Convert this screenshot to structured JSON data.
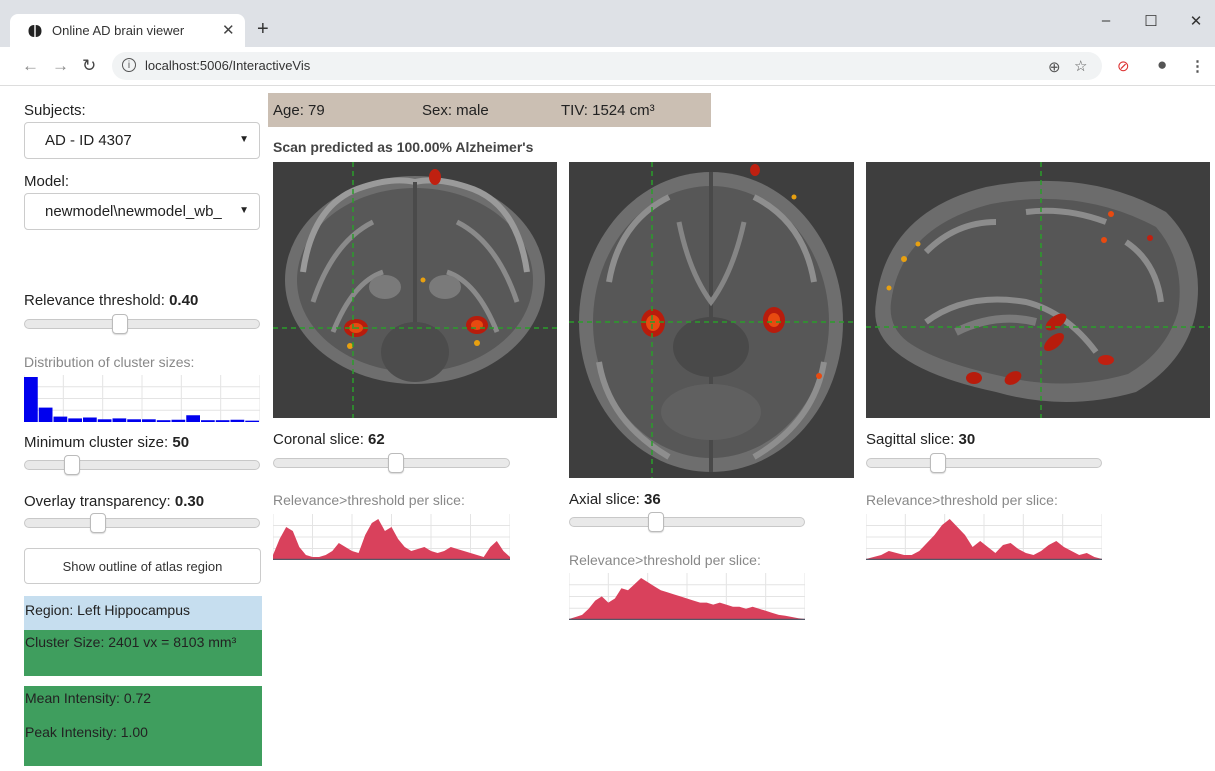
{
  "browser": {
    "tab_title": "Online AD brain viewer",
    "url": "localhost:5006/InteractiveVis"
  },
  "sidebar": {
    "subjects_label": "Subjects:",
    "subject_value": "AD - ID 4307",
    "model_label": "Model:",
    "model_value": "newmodel\\newmodel_wb_",
    "relevance_label": "Relevance threshold:",
    "relevance_value": "0.40",
    "relevance_fraction": 0.4,
    "distribution_label": "Distribution of cluster sizes:",
    "distribution_values": [
      1.0,
      0.32,
      0.12,
      0.08,
      0.1,
      0.06,
      0.08,
      0.06,
      0.06,
      0.04,
      0.05,
      0.15,
      0.04,
      0.04,
      0.05,
      0.03
    ],
    "min_cluster_label": "Minimum cluster size:",
    "min_cluster_value": "50",
    "min_cluster_fraction": 0.18,
    "overlay_label": "Overlay transparency:",
    "overlay_value": "0.30",
    "overlay_fraction": 0.3,
    "atlas_button": "Show outline of atlas region",
    "region": "Region: Left Hippocampus",
    "cluster_size": "Cluster Size: 2401 vx = 8103 mm³",
    "mean_intensity": "Mean Intensity: 0.72",
    "peak_intensity": "Peak Intensity: 1.00"
  },
  "subject_info": {
    "age": "Age: 79",
    "sex": "Sex: male",
    "tiv": "TIV: 1524 cm³"
  },
  "prediction": "Scan predicted as 100.00% Alzheimer's",
  "views": {
    "coronal": {
      "slice_label": "Coronal slice:",
      "slice_value": "62",
      "slider_fraction": 0.52,
      "chart_label": "Relevance>threshold per slice:",
      "profile": [
        0.1,
        0.5,
        0.8,
        0.7,
        0.3,
        0.1,
        0.05,
        0.05,
        0.1,
        0.2,
        0.4,
        0.3,
        0.2,
        0.15,
        0.6,
        0.9,
        1.0,
        0.7,
        0.8,
        0.5,
        0.3,
        0.2,
        0.25,
        0.3,
        0.2,
        0.15,
        0.2,
        0.3,
        0.25,
        0.2,
        0.15,
        0.1,
        0.05,
        0.3,
        0.45,
        0.2,
        0.05
      ]
    },
    "axial": {
      "slice_label": "Axial slice:",
      "slice_value": "36",
      "slider_fraction": 0.36,
      "chart_label": "Relevance>threshold per slice:",
      "profile": [
        0.0,
        0.05,
        0.1,
        0.25,
        0.45,
        0.55,
        0.4,
        0.5,
        0.75,
        0.7,
        0.85,
        1.0,
        0.9,
        0.8,
        0.7,
        0.65,
        0.6,
        0.55,
        0.5,
        0.45,
        0.4,
        0.4,
        0.35,
        0.4,
        0.35,
        0.3,
        0.3,
        0.25,
        0.3,
        0.25,
        0.2,
        0.15,
        0.1,
        0.08,
        0.05,
        0.02,
        0.0
      ]
    },
    "sagittal": {
      "slice_label": "Sagittal slice:",
      "slice_value": "30",
      "slider_fraction": 0.29,
      "chart_label": "Relevance>threshold per slice:",
      "profile": [
        0.0,
        0.05,
        0.1,
        0.2,
        0.15,
        0.1,
        0.1,
        0.2,
        0.4,
        0.6,
        0.85,
        1.0,
        0.8,
        0.6,
        0.3,
        0.45,
        0.3,
        0.15,
        0.35,
        0.4,
        0.25,
        0.15,
        0.1,
        0.2,
        0.35,
        0.45,
        0.3,
        0.2,
        0.1,
        0.15,
        0.05,
        0.0
      ]
    }
  },
  "colors": {
    "demo_bg": "#cbbfb3",
    "region_bg": "#c6deef",
    "cluster_bg": "#3f9e5e",
    "profile_fill": "#d9415c",
    "hist_fill": "#0000ee",
    "crosshair": "#2a9d2a"
  }
}
